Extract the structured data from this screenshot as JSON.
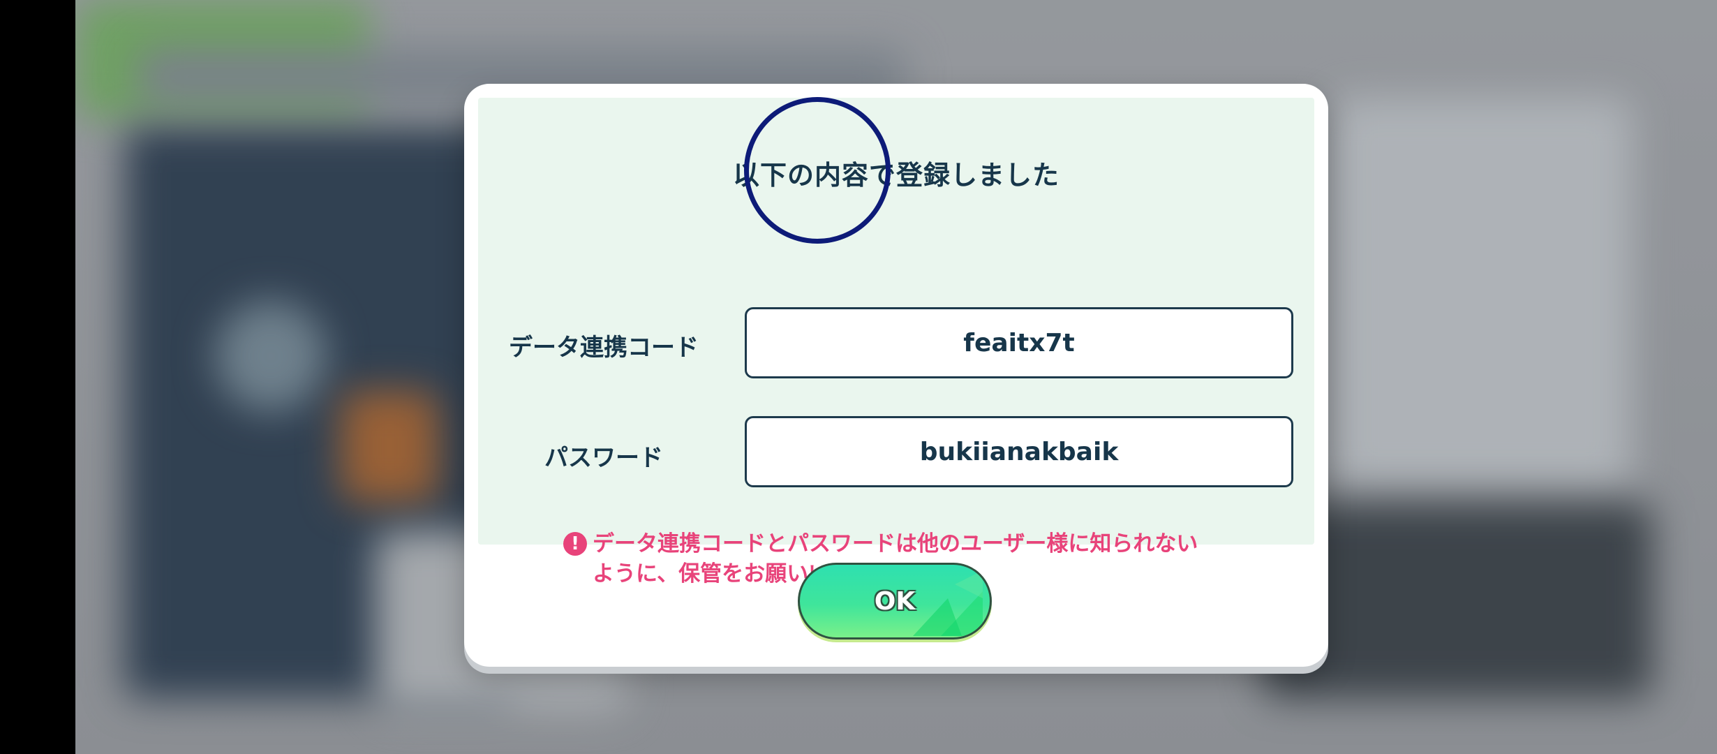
{
  "dialog": {
    "title": "以下の内容で登録しました",
    "fields": [
      {
        "label": "データ連携コード",
        "value": "feaitx7t"
      },
      {
        "label": "パスワード",
        "value": "bukiianakbaik"
      }
    ],
    "notice": {
      "icon": "exclamation-icon",
      "line1": "データ連携コードとパスワードは他のユーザー様に知られない",
      "line2": "ように、保管をお願いいたします"
    },
    "ok_button": {
      "label": "OK"
    }
  },
  "colors": {
    "panel_bg": "#eaf6ee",
    "text_dark": "#17364a",
    "notice_pink": "#e8437a",
    "button_green": "#3fe59b",
    "tap_ring": "#0d1b78"
  }
}
